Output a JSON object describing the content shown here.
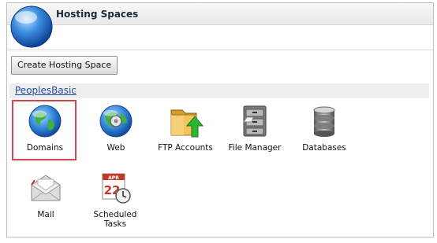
{
  "panel": {
    "title": "Hosting Spaces"
  },
  "toolbar": {
    "create_label": "Create Hosting Space"
  },
  "group": {
    "name": "PeoplesBasic"
  },
  "tiles": [
    {
      "label": "Domains",
      "icon": "globe-icon",
      "selected": true
    },
    {
      "label": "Web",
      "icon": "globe-gear-icon"
    },
    {
      "label": "FTP Accounts",
      "icon": "folder-upload-icon"
    },
    {
      "label": "File Manager",
      "icon": "file-cabinet-icon"
    },
    {
      "label": "Databases",
      "icon": "database-icon"
    },
    {
      "label": "Mail",
      "icon": "envelope-icon"
    },
    {
      "label": "Scheduled Tasks",
      "icon": "calendar-clock-icon"
    }
  ],
  "calendar": {
    "month": "APR",
    "day": "22"
  },
  "colors": {
    "selected_border": "#d0464a",
    "link": "#1a4e9a"
  }
}
